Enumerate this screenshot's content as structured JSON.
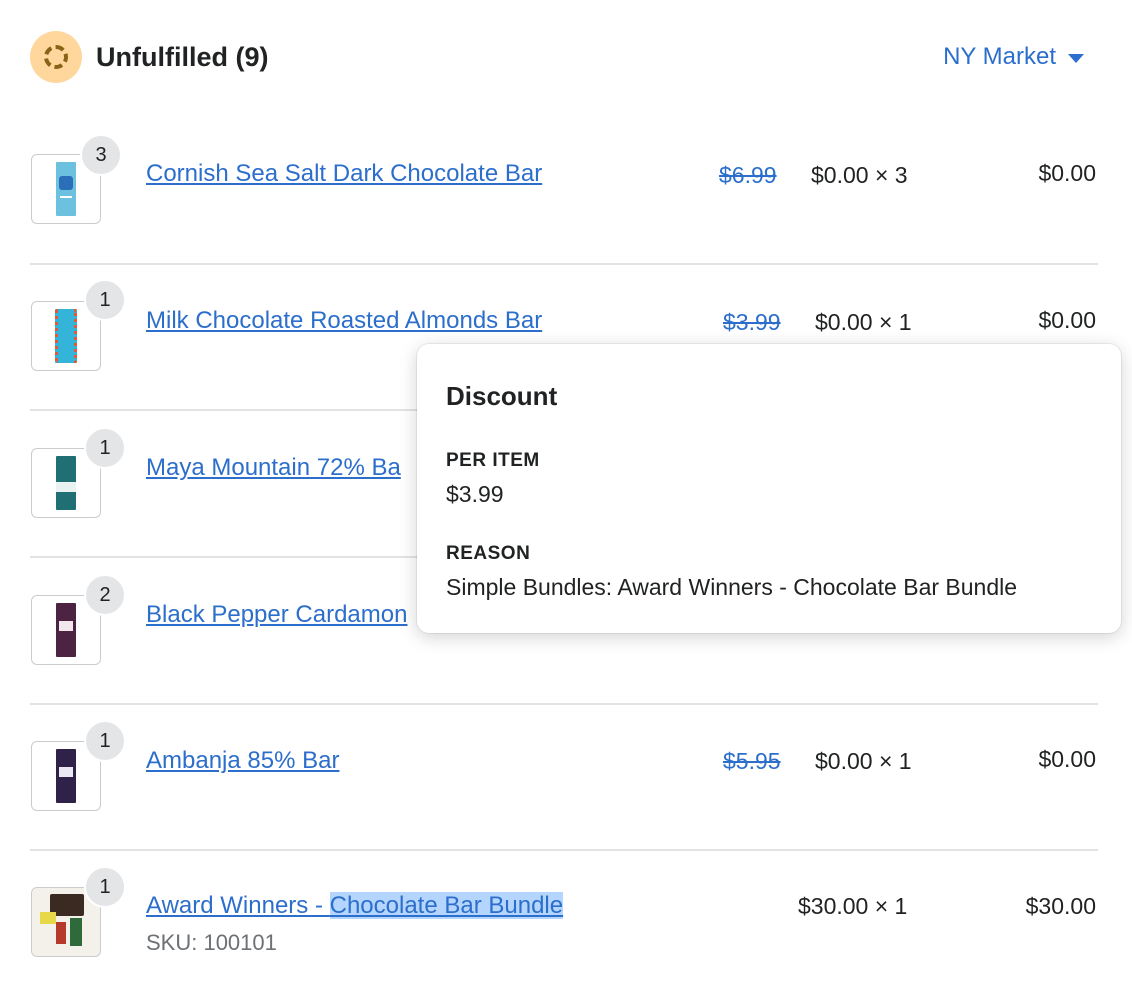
{
  "header": {
    "title": "Unfulfilled (9)",
    "market": "NY Market"
  },
  "items": [
    {
      "qty": "3",
      "name": "Cornish Sea Salt Dark Chocolate Bar",
      "original_price": "$6.99",
      "unit_price": "$0.00 × 3",
      "total": "$0.00"
    },
    {
      "qty": "1",
      "name": "Milk Chocolate Roasted Almonds Bar",
      "original_price": "$3.99",
      "unit_price": "$0.00 × 1",
      "total": "$0.00"
    },
    {
      "qty": "1",
      "name": "Maya Mountain 72% Ba"
    },
    {
      "qty": "2",
      "name": "Black Pepper Cardamon"
    },
    {
      "qty": "1",
      "name": "Ambanja 85% Bar",
      "original_price": "$5.95",
      "unit_price": "$0.00 × 1",
      "total": "$0.00"
    },
    {
      "qty": "1",
      "name_part1": "Award Winners - ",
      "name_part2": "Chocolate Bar Bundle",
      "sku": "SKU: 100101",
      "unit_price": "$30.00 × 1",
      "total": "$30.00"
    }
  ],
  "discount_popover": {
    "title": "Discount",
    "per_item_label": "PER ITEM",
    "per_item_value": "$3.99",
    "reason_label": "REASON",
    "reason_value": "Simple Bundles: Award Winners - Chocolate Bar Bundle"
  },
  "colors": {
    "link": "#2c6ecb",
    "text": "#202223",
    "badge": "#e4e5e7",
    "status_bg": "#ffd79d",
    "selection": "#b4d5fe"
  }
}
